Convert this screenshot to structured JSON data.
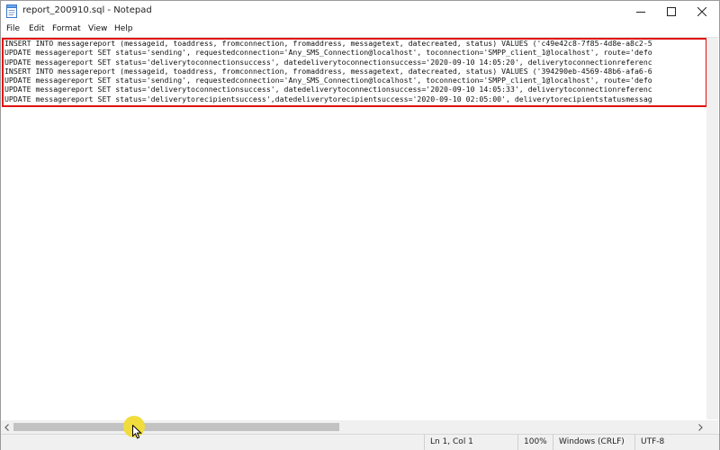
{
  "window": {
    "title": "report_200910.sql - Notepad",
    "icon": "notepad-icon"
  },
  "window_controls": {
    "minimize": "minimize-icon",
    "maximize": "maximize-icon",
    "close": "close-icon"
  },
  "menu": {
    "items": [
      "File",
      "Edit",
      "Format",
      "View",
      "Help"
    ]
  },
  "editor": {
    "lines": [
      "INSERT INTO messagereport (messageid, toaddress, fromconnection, fromaddress, messagetext, datecreated, status) VALUES ('c49e42c8-7f85-4d8e-a8c2-5",
      "UPDATE messagereport SET status='sending', requestedconnection='Any_SMS_Connection@localhost', toconnection='SMPP_client_1@localhost', route='defo",
      "UPDATE messagereport SET status='deliverytoconnectionsuccess', datedeliverytoconnectionsuccess='2020-09-10 14:05:20', deliverytoconnectionreferenc",
      "INSERT INTO messagereport (messageid, toaddress, fromconnection, fromaddress, messagetext, datecreated, status) VALUES ('394290eb-4569-48b6-afa6-6",
      "UPDATE messagereport SET status='sending', requestedconnection='Any_SMS_Connection@localhost', toconnection='SMPP_client_1@localhost', route='defo",
      "UPDATE messagereport SET status='deliverytoconnectionsuccess', datedeliverytoconnectionsuccess='2020-09-10 14:05:33', deliverytoconnectionreferenc",
      "UPDATE messagereport SET status='deliverytorecipientsuccess',datedeliverytorecipientsuccess='2020-09-10 02:05:00', deliverytorecipientstatusmessag"
    ],
    "highlight_color": "#e01010"
  },
  "scrollbar": {
    "horizontal_position": 0.0
  },
  "statusbar": {
    "position": "Ln 1, Col 1",
    "zoom": "100%",
    "line_endings": "Windows (CRLF)",
    "encoding": "UTF-8"
  },
  "cursor": {
    "highlight_color": "#f0dc3c"
  }
}
